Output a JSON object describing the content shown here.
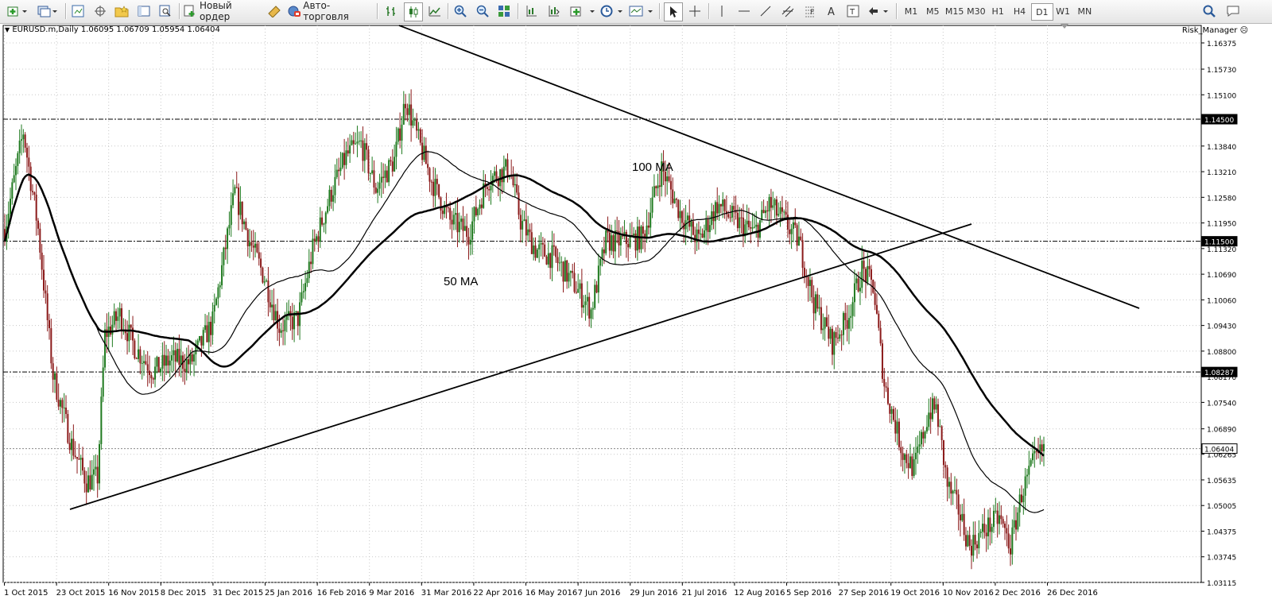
{
  "toolbar": {
    "new_order_label": "Новый ордер",
    "autotrading_label": "Авто-торговля",
    "timeframes": [
      "M1",
      "M5",
      "M15",
      "M30",
      "H1",
      "H4",
      "D1",
      "W1",
      "MN"
    ],
    "active_timeframe": "D1"
  },
  "chart": {
    "symbol_info": "EURUSD.m,Daily  1.06095 1.06709 1.05954 1.06404",
    "ea_label": "Risk_Manager",
    "annotations": {
      "ma100": "100 MA",
      "ma50": "50 MA"
    },
    "price_ticks": [
      "1.16375",
      "1.15730",
      "1.15100",
      "1.13840",
      "1.13210",
      "1.12580",
      "1.11950",
      "1.11320",
      "1.10690",
      "1.10060",
      "1.09430",
      "1.08800",
      "1.08170",
      "1.07540",
      "1.06890",
      "1.06265",
      "1.05635",
      "1.05005",
      "1.04375",
      "1.03745",
      "1.03115"
    ],
    "price_labels": [
      {
        "price": 1.145,
        "text": "1.14500"
      },
      {
        "price": 1.115,
        "text": "1.11500"
      },
      {
        "price": 1.08287,
        "text": "1.08287"
      },
      {
        "price": 1.06404,
        "text": "1.06404"
      }
    ],
    "date_ticks": [
      "1 Oct 2015",
      "23 Oct 2015",
      "16 Nov 2015",
      "8 Dec 2015",
      "31 Dec 2015",
      "25 Jan 2016",
      "16 Feb 2016",
      "9 Mar 2016",
      "31 Mar 2016",
      "22 Apr 2016",
      "16 May 2016",
      "7 Jun 2016",
      "29 Jun 2016",
      "21 Jul 2016",
      "12 Aug 2016",
      "5 Sep 2016",
      "27 Sep 2016",
      "19 Oct 2016",
      "10 Nov 2016",
      "2 Dec 2016",
      "26 Dec 2016"
    ],
    "colors": {
      "bull": "#1f7a1f",
      "bear": "#8b1a1a",
      "line": "#000000",
      "grid": "#c8c8c8"
    }
  }
}
